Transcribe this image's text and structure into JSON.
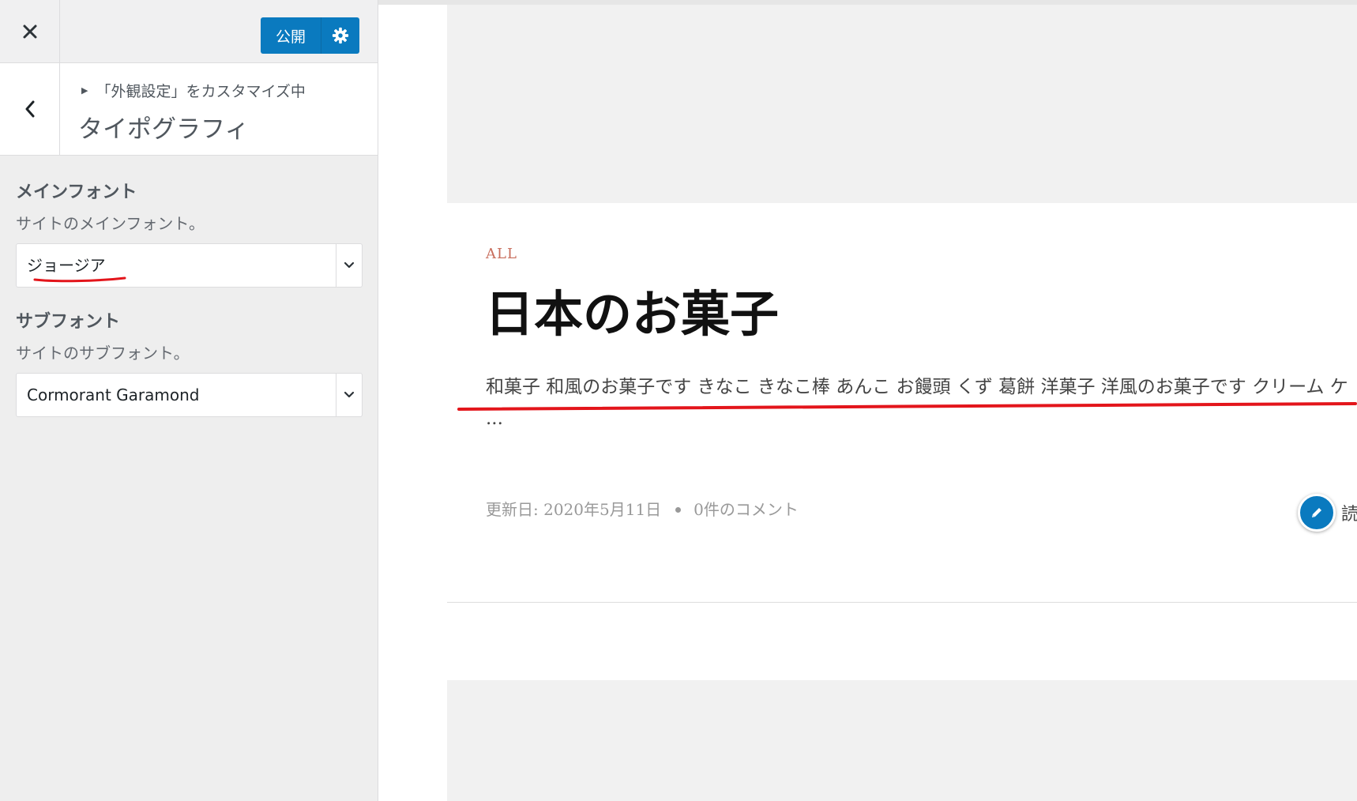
{
  "topbar": {
    "close_icon": "close-icon",
    "publish_label": "公開",
    "settings_icon": "gear-icon"
  },
  "section": {
    "back_icon": "chevron-left-icon",
    "breadcrumb": "「外観設定」をカスタマイズ中",
    "title": "タイポグラフィ"
  },
  "controls": {
    "main_font": {
      "label": "メインフォント",
      "description": "サイトのメインフォント。",
      "value": "ジョージア"
    },
    "sub_font": {
      "label": "サブフォント",
      "description": "サイトのサブフォント。",
      "value": "Cormorant Garamond"
    }
  },
  "preview": {
    "post": {
      "category": "ALL",
      "title": "日本のお菓子",
      "excerpt": "和菓子 和風のお菓子です きなこ きなこ棒 あんこ お饅頭 くず 葛餅 洋菓子 洋風のお菓子です クリーム ケ ...",
      "updated": "更新日: 2020年5月11日",
      "comments": "0件のコメント",
      "read_more": "読"
    }
  },
  "colors": {
    "accent": "#0a7abf",
    "category": "#c86d5c",
    "annotation": "#e3151b"
  }
}
